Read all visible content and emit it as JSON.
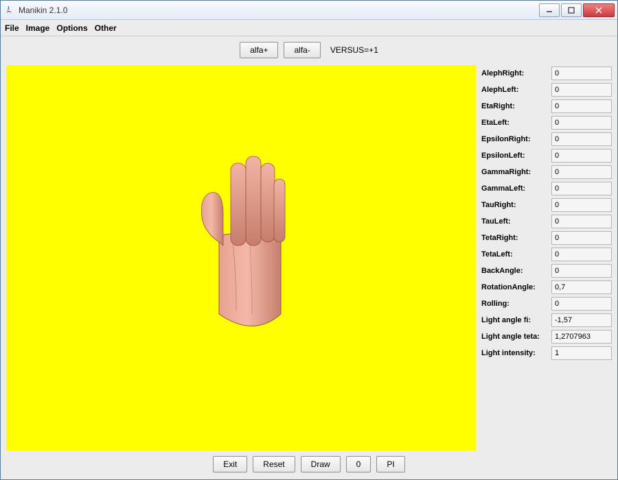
{
  "window": {
    "title": "Manikin 2.1.0"
  },
  "menu": {
    "items": [
      "File",
      "Image",
      "Options",
      "Other"
    ]
  },
  "top_toolbar": {
    "alfa_plus": "alfa+",
    "alfa_minus": "alfa-",
    "versus_label": "VERSUS=+1"
  },
  "parameters": [
    {
      "label": "AlephRight:",
      "value": "0"
    },
    {
      "label": "AlephLeft:",
      "value": "0"
    },
    {
      "label": "EtaRight:",
      "value": "0"
    },
    {
      "label": "EtaLeft:",
      "value": "0"
    },
    {
      "label": "EpsilonRight:",
      "value": "0"
    },
    {
      "label": "EpsilonLeft:",
      "value": "0"
    },
    {
      "label": "GammaRight:",
      "value": "0"
    },
    {
      "label": "GammaLeft:",
      "value": "0"
    },
    {
      "label": "TauRight:",
      "value": "0"
    },
    {
      "label": "TauLeft:",
      "value": "0"
    },
    {
      "label": "TetaRight:",
      "value": "0"
    },
    {
      "label": "TetaLeft:",
      "value": "0"
    },
    {
      "label": "BackAngle:",
      "value": "0"
    },
    {
      "label": "RotationAngle:",
      "value": "0,7"
    },
    {
      "label": "Rolling:",
      "value": "0"
    },
    {
      "label": "Light angle fi:",
      "value": "-1,57"
    },
    {
      "label": "Light angle teta:",
      "value": "1,2707963"
    },
    {
      "label": "Light intensity:",
      "value": "1"
    }
  ],
  "bottom_toolbar": {
    "exit": "Exit",
    "reset": "Reset",
    "draw": "Draw",
    "zero": "0",
    "pi": "PI"
  },
  "colors": {
    "viewport_bg": "#ffff00",
    "skin_light": "#f4b8a8",
    "skin_mid": "#dd917f",
    "skin_dark": "#b5644f"
  },
  "viewport": {
    "model": "hand"
  }
}
